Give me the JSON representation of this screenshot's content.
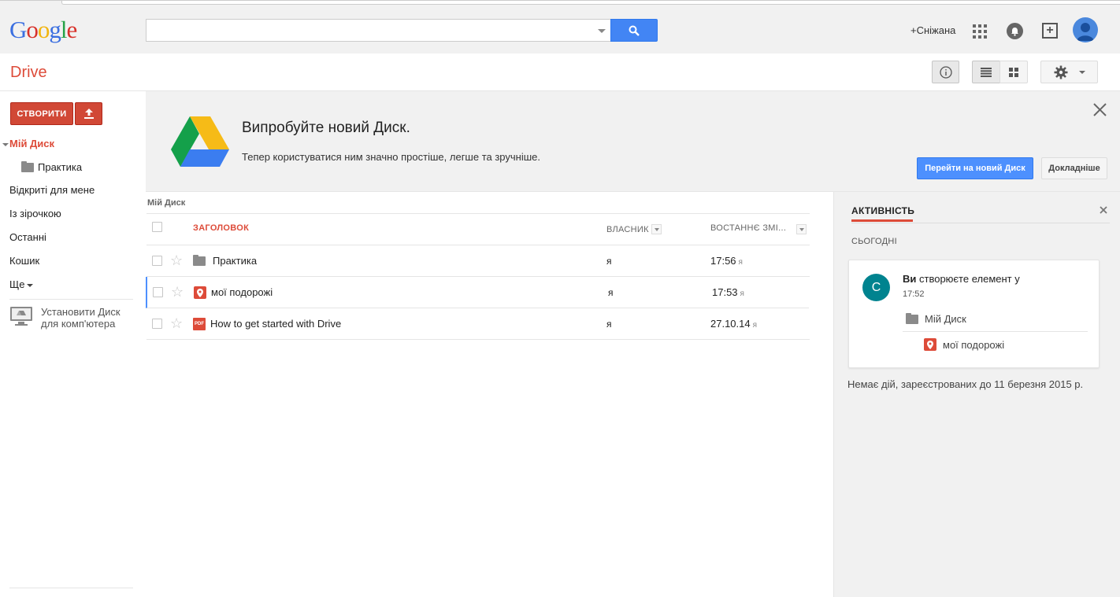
{
  "header": {
    "logo_text": "Google",
    "search": {
      "value": "",
      "placeholder": ""
    },
    "user_link": "+Сніжана"
  },
  "drive": {
    "title": "Drive"
  },
  "leftnav": {
    "create_label": "СТВОРИТИ",
    "my_drive": "Мій Диск",
    "folder_practice": "Практика",
    "items": [
      {
        "label": "Відкриті для мене"
      },
      {
        "label": "Із зірочкою"
      },
      {
        "label": "Останні"
      },
      {
        "label": "Кошик"
      },
      {
        "label": "Ще"
      }
    ],
    "install_line1": "Установити Диск",
    "install_line2": "для комп'ютера"
  },
  "promo": {
    "title": "Випробуйте новий Диск.",
    "description": "Тепер користуватися ним значно простіше, легше та зручніше.",
    "go_button": "Перейти на новий Диск",
    "more_button": "Докладніше"
  },
  "filelist": {
    "breadcrumb": "Мій Диск",
    "columns": {
      "title": "ЗАГОЛОВОК",
      "owner": "ВЛАСНИК",
      "modified": "ВОСТАННЄ ЗМІ..."
    },
    "rows": [
      {
        "name": "Практика",
        "type": "folder-icon",
        "owner": "я",
        "time": "17:56",
        "by": "я"
      },
      {
        "name": "мої подорожі",
        "type": "map-icon",
        "owner": "я",
        "time": "17:53",
        "by": "я"
      },
      {
        "name": "How to get started with Drive",
        "type": "pdf-icon",
        "owner": "я",
        "time": "27.10.14",
        "by": "я"
      }
    ]
  },
  "activity": {
    "tab_label": "АКТИВНІСТЬ",
    "today_label": "СЬОГОДНІ",
    "card": {
      "avatar_letter": "C",
      "actor": "Ви",
      "action": " створюєте елемент у",
      "time": "17:52",
      "folder": "Мій Диск",
      "file": "мої подорожі"
    },
    "footer": "Немає дій, зареєстрованих до 11 березня 2015 р."
  },
  "colors": {
    "accent_red": "#dd4b39",
    "accent_blue": "#4d90fe",
    "activity_avatar": "#00838f"
  }
}
